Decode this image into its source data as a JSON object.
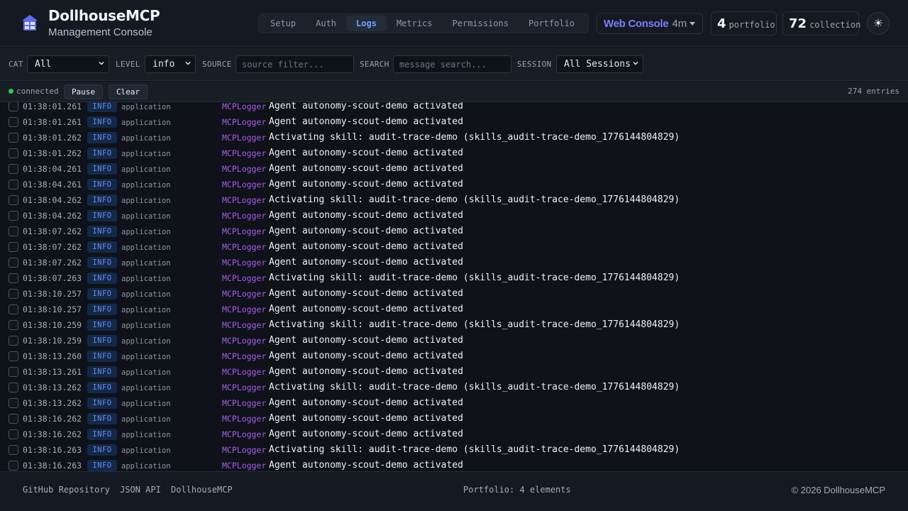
{
  "brand": {
    "title": "DollhouseMCP",
    "subtitle": "Management Console",
    "icon": "dollhouse-icon"
  },
  "nav": {
    "tabs": [
      "Setup",
      "Auth",
      "Logs",
      "Metrics",
      "Permissions",
      "Portfolio"
    ],
    "active": "Logs"
  },
  "console": {
    "name": "Web Console",
    "age": "4m"
  },
  "stats": {
    "portfolio": {
      "count": "4",
      "label": "portfolio"
    },
    "collection": {
      "count": "72",
      "label": "collection"
    }
  },
  "theme_toggle": {
    "glyph": "☀",
    "icon": "sun-icon"
  },
  "filters": {
    "cat_label": "CAT",
    "cat_value": "All",
    "level_label": "LEVEL",
    "level_value": "info",
    "source_label": "SOURCE",
    "source_placeholder": "source filter...",
    "search_label": "SEARCH",
    "search_placeholder": "message search...",
    "session_label": "SESSION",
    "session_value": "All Sessions"
  },
  "status": {
    "connection": "connected",
    "pause_label": "Pause",
    "clear_label": "Clear",
    "entries": "274 entries"
  },
  "colors": {
    "accent": "#6aa3ff",
    "console": "#7b7dfa",
    "source": "#a65cf0",
    "level_bg": "#16284a",
    "level_text": "#5b8ff0",
    "connected": "#34c759"
  },
  "logs": [
    {
      "time": "01:38:01.261",
      "level": "INFO",
      "category": "application",
      "source": "MCPLogger",
      "message": "Agent autonomy-scout-demo activated"
    },
    {
      "time": "01:38:01.261",
      "level": "INFO",
      "category": "application",
      "source": "MCPLogger",
      "message": "Agent autonomy-scout-demo activated"
    },
    {
      "time": "01:38:01.262",
      "level": "INFO",
      "category": "application",
      "source": "MCPLogger",
      "message": "Activating skill: audit-trace-demo (skills_audit-trace-demo_1776144804829)"
    },
    {
      "time": "01:38:01.262",
      "level": "INFO",
      "category": "application",
      "source": "MCPLogger",
      "message": "Agent autonomy-scout-demo activated"
    },
    {
      "time": "01:38:04.261",
      "level": "INFO",
      "category": "application",
      "source": "MCPLogger",
      "message": "Agent autonomy-scout-demo activated"
    },
    {
      "time": "01:38:04.261",
      "level": "INFO",
      "category": "application",
      "source": "MCPLogger",
      "message": "Agent autonomy-scout-demo activated"
    },
    {
      "time": "01:38:04.262",
      "level": "INFO",
      "category": "application",
      "source": "MCPLogger",
      "message": "Activating skill: audit-trace-demo (skills_audit-trace-demo_1776144804829)"
    },
    {
      "time": "01:38:04.262",
      "level": "INFO",
      "category": "application",
      "source": "MCPLogger",
      "message": "Agent autonomy-scout-demo activated"
    },
    {
      "time": "01:38:07.262",
      "level": "INFO",
      "category": "application",
      "source": "MCPLogger",
      "message": "Agent autonomy-scout-demo activated"
    },
    {
      "time": "01:38:07.262",
      "level": "INFO",
      "category": "application",
      "source": "MCPLogger",
      "message": "Agent autonomy-scout-demo activated"
    },
    {
      "time": "01:38:07.262",
      "level": "INFO",
      "category": "application",
      "source": "MCPLogger",
      "message": "Agent autonomy-scout-demo activated"
    },
    {
      "time": "01:38:07.263",
      "level": "INFO",
      "category": "application",
      "source": "MCPLogger",
      "message": "Activating skill: audit-trace-demo (skills_audit-trace-demo_1776144804829)"
    },
    {
      "time": "01:38:10.257",
      "level": "INFO",
      "category": "application",
      "source": "MCPLogger",
      "message": "Agent autonomy-scout-demo activated"
    },
    {
      "time": "01:38:10.257",
      "level": "INFO",
      "category": "application",
      "source": "MCPLogger",
      "message": "Agent autonomy-scout-demo activated"
    },
    {
      "time": "01:38:10.259",
      "level": "INFO",
      "category": "application",
      "source": "MCPLogger",
      "message": "Activating skill: audit-trace-demo (skills_audit-trace-demo_1776144804829)"
    },
    {
      "time": "01:38:10.259",
      "level": "INFO",
      "category": "application",
      "source": "MCPLogger",
      "message": "Agent autonomy-scout-demo activated"
    },
    {
      "time": "01:38:13.260",
      "level": "INFO",
      "category": "application",
      "source": "MCPLogger",
      "message": "Agent autonomy-scout-demo activated"
    },
    {
      "time": "01:38:13.261",
      "level": "INFO",
      "category": "application",
      "source": "MCPLogger",
      "message": "Agent autonomy-scout-demo activated"
    },
    {
      "time": "01:38:13.262",
      "level": "INFO",
      "category": "application",
      "source": "MCPLogger",
      "message": "Activating skill: audit-trace-demo (skills_audit-trace-demo_1776144804829)"
    },
    {
      "time": "01:38:13.262",
      "level": "INFO",
      "category": "application",
      "source": "MCPLogger",
      "message": "Agent autonomy-scout-demo activated"
    },
    {
      "time": "01:38:16.262",
      "level": "INFO",
      "category": "application",
      "source": "MCPLogger",
      "message": "Agent autonomy-scout-demo activated"
    },
    {
      "time": "01:38:16.262",
      "level": "INFO",
      "category": "application",
      "source": "MCPLogger",
      "message": "Agent autonomy-scout-demo activated"
    },
    {
      "time": "01:38:16.263",
      "level": "INFO",
      "category": "application",
      "source": "MCPLogger",
      "message": "Activating skill: audit-trace-demo (skills_audit-trace-demo_1776144804829)"
    },
    {
      "time": "01:38:16.263",
      "level": "INFO",
      "category": "application",
      "source": "MCPLogger",
      "message": "Agent autonomy-scout-demo activated"
    }
  ],
  "footer": {
    "links": [
      "GitHub Repository",
      "JSON API",
      "DollhouseMCP"
    ],
    "center": "Portfolio: 4 elements",
    "copyright": "© 2026 DollhouseMCP"
  }
}
